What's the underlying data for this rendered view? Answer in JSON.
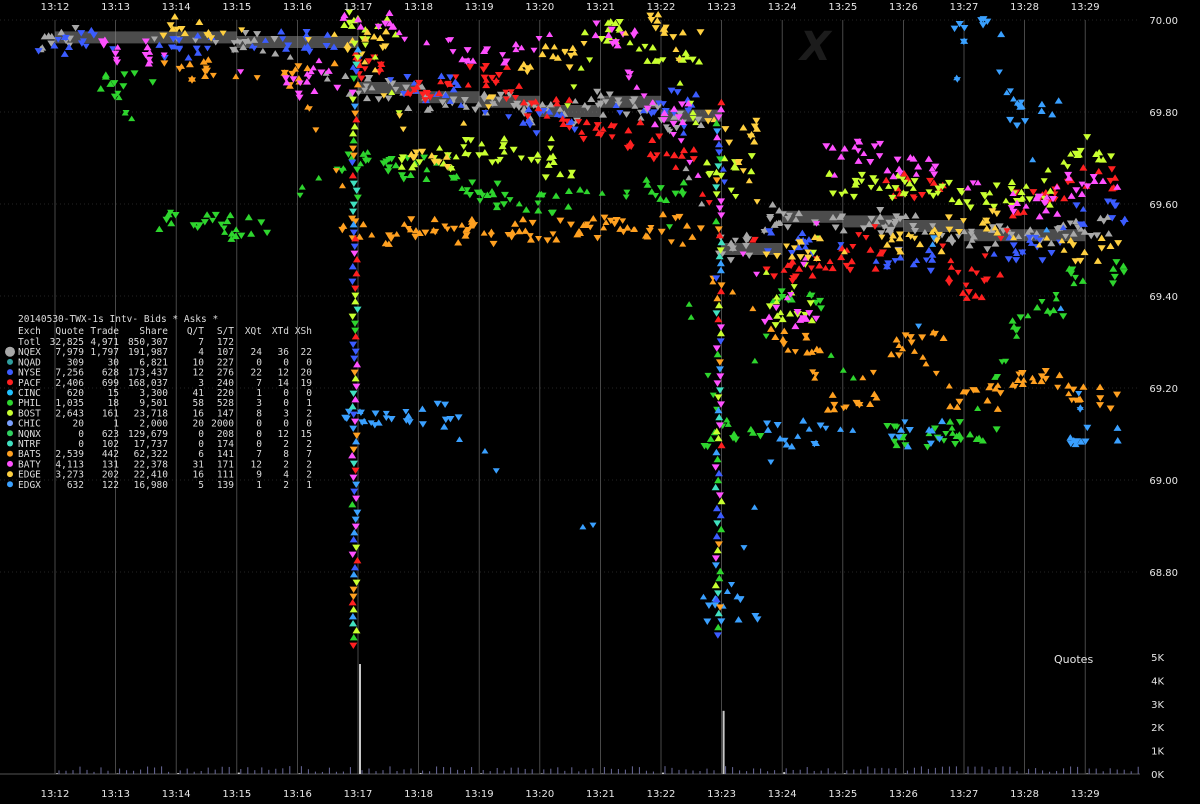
{
  "chart_data": [
    {
      "type": "scatter",
      "title": "",
      "xlabel": "",
      "ylabel": "",
      "x_ticks": [
        "13:12",
        "13:13",
        "13:14",
        "13:15",
        "13:16",
        "13:17",
        "13:18",
        "13:19",
        "13:20",
        "13:21",
        "13:22",
        "13:23",
        "13:24",
        "13:25",
        "13:26",
        "13:27",
        "13:28",
        "13:29"
      ],
      "y_ticks": [
        "70.00",
        "69.80",
        "69.60",
        "69.40",
        "69.20",
        "69.00",
        "68.80"
      ],
      "ylim": [
        68.6,
        70.05
      ],
      "grid": true,
      "watermark": "X",
      "legend": {
        "title": "20140530-TWX-1s Intv- Bids * Asks *",
        "columns": [
          "Exch",
          "Quote",
          "Trade",
          "Share",
          "Q/T",
          "S/T",
          "XQt",
          "XTd",
          "XSh"
        ],
        "rows": [
          {
            "exch": "Totl",
            "quote": "32,825",
            "trade": "4,971",
            "share": "850,307",
            "qt": "7",
            "st": "172",
            "xqt": "",
            "xtd": "",
            "xsh": "",
            "color": ""
          },
          {
            "exch": "NQEX",
            "quote": "7,979",
            "trade": "1,797",
            "share": "191,987",
            "qt": "4",
            "st": "107",
            "xqt": "24",
            "xtd": "36",
            "xsh": "22",
            "color": "#a8a8a8"
          },
          {
            "exch": "NQAD",
            "quote": "309",
            "trade": "30",
            "share": "6,821",
            "qt": "10",
            "st": "227",
            "xqt": "0",
            "xtd": "0",
            "xsh": "0",
            "color": "#2f9e9e"
          },
          {
            "exch": "NYSE",
            "quote": "7,256",
            "trade": "628",
            "share": "173,437",
            "qt": "12",
            "st": "276",
            "xqt": "22",
            "xtd": "12",
            "xsh": "20",
            "color": "#3b5cff"
          },
          {
            "exch": "PACF",
            "quote": "2,406",
            "trade": "699",
            "share": "168,037",
            "qt": "3",
            "st": "240",
            "xqt": "7",
            "xtd": "14",
            "xsh": "19",
            "color": "#ff2020"
          },
          {
            "exch": "CINC",
            "quote": "620",
            "trade": "15",
            "share": "3,300",
            "qt": "41",
            "st": "220",
            "xqt": "1",
            "xtd": "0",
            "xsh": "0",
            "color": "#20c0ff"
          },
          {
            "exch": "PHIL",
            "quote": "1,035",
            "trade": "18",
            "share": "9,501",
            "qt": "58",
            "st": "528",
            "xqt": "3",
            "xtd": "0",
            "xsh": "1",
            "color": "#2ed52e"
          },
          {
            "exch": "BOST",
            "quote": "2,643",
            "trade": "161",
            "share": "23,718",
            "qt": "16",
            "st": "147",
            "xqt": "8",
            "xtd": "3",
            "xsh": "2",
            "color": "#c8ff30"
          },
          {
            "exch": "CHIC",
            "quote": "20",
            "trade": "1",
            "share": "2,000",
            "qt": "20",
            "st": "2000",
            "xqt": "0",
            "xtd": "0",
            "xsh": "0",
            "color": "#7aa0ff"
          },
          {
            "exch": "NQNX",
            "quote": "0",
            "trade": "623",
            "share": "129,679",
            "qt": "0",
            "st": "208",
            "xqt": "0",
            "xtd": "12",
            "xsh": "15",
            "color": "#30d060"
          },
          {
            "exch": "NTRF",
            "quote": "0",
            "trade": "102",
            "share": "17,737",
            "qt": "0",
            "st": "174",
            "xqt": "0",
            "xtd": "2",
            "xsh": "2",
            "color": "#40e0c0"
          },
          {
            "exch": "BATS",
            "quote": "2,539",
            "trade": "442",
            "share": "62,322",
            "qt": "6",
            "st": "141",
            "xqt": "7",
            "xtd": "8",
            "xsh": "7",
            "color": "#ffa020"
          },
          {
            "exch": "BATY",
            "quote": "4,113",
            "trade": "131",
            "share": "22,378",
            "qt": "31",
            "st": "171",
            "xqt": "12",
            "xtd": "2",
            "xsh": "2",
            "color": "#ff50ff"
          },
          {
            "exch": "EDGE",
            "quote": "3,273",
            "trade": "202",
            "share": "22,410",
            "qt": "16",
            "st": "111",
            "xqt": "9",
            "xtd": "4",
            "xsh": "2",
            "color": "#ffd040"
          },
          {
            "exch": "EDGX",
            "quote": "632",
            "trade": "122",
            "share": "16,980",
            "qt": "5",
            "st": "139",
            "xqt": "1",
            "xtd": "2",
            "xsh": "1",
            "color": "#3aa0ff"
          }
        ]
      },
      "series": [
        {
          "name": "NQEX",
          "color": "#a8a8a8",
          "x": [
            "13:12",
            "13:15",
            "13:17",
            "13:18",
            "13:19",
            "13:20",
            "13:21",
            "13:22",
            "13:23",
            "13:24",
            "13:25",
            "13:26",
            "13:27",
            "13:28",
            "13:29"
          ],
          "y": [
            69.96,
            69.95,
            69.85,
            69.83,
            69.82,
            69.8,
            69.82,
            69.79,
            69.5,
            69.57,
            69.56,
            69.55,
            69.53,
            69.53,
            69.55
          ]
        },
        {
          "name": "NYSE",
          "color": "#3b5cff",
          "x": [
            "13:12",
            "13:14",
            "13:16",
            "13:18",
            "13:20",
            "13:22",
            "13:24",
            "13:26",
            "13:28",
            "13:29"
          ],
          "y": [
            69.95,
            69.94,
            69.96,
            69.85,
            69.78,
            69.82,
            69.52,
            69.48,
            69.5,
            69.58
          ]
        },
        {
          "name": "PACF",
          "color": "#ff2020",
          "x": [
            "13:17",
            "13:18",
            "13:19",
            "13:20",
            "13:21",
            "13:22",
            "13:24",
            "13:25",
            "13:26",
            "13:27",
            "13:28",
            "13:29"
          ],
          "y": [
            69.9,
            69.84,
            69.88,
            69.8,
            69.75,
            69.72,
            69.45,
            69.48,
            69.64,
            69.42,
            69.6,
            69.65
          ]
        },
        {
          "name": "PHIL",
          "color": "#2ed52e",
          "x": [
            "13:13",
            "13:14",
            "13:15",
            "13:17",
            "13:18",
            "13:19",
            "13:20",
            "13:22",
            "13:23",
            "13:24",
            "13:26",
            "13:27",
            "13:28",
            "13:29"
          ],
          "y": [
            69.86,
            69.55,
            69.55,
            69.7,
            69.68,
            69.62,
            69.61,
            69.63,
            69.1,
            69.4,
            69.1,
            69.1,
            69.35,
            69.45
          ]
        },
        {
          "name": "BOST",
          "color": "#c8ff30",
          "x": [
            "13:17",
            "13:18",
            "13:19",
            "13:20",
            "13:21",
            "13:22",
            "13:23",
            "13:24",
            "13:25",
            "13:26",
            "13:27",
            "13:28",
            "13:29"
          ],
          "y": [
            69.99,
            69.7,
            69.72,
            69.68,
            69.98,
            69.93,
            69.68,
            69.36,
            69.64,
            69.64,
            69.62,
            69.62,
            69.72
          ]
        },
        {
          "name": "BATS",
          "color": "#ffa020",
          "x": [
            "13:14",
            "13:16",
            "13:17",
            "13:18",
            "13:19",
            "13:20",
            "13:21",
            "13:22",
            "13:24",
            "13:25",
            "13:26",
            "13:27",
            "13:28",
            "13:29"
          ],
          "y": [
            69.89,
            69.88,
            69.54,
            69.54,
            69.54,
            69.54,
            69.55,
            69.55,
            69.3,
            69.16,
            69.3,
            69.18,
            69.22,
            69.18
          ]
        },
        {
          "name": "BATY",
          "color": "#ff50ff",
          "x": [
            "13:13",
            "13:16",
            "13:17",
            "13:19",
            "13:21",
            "13:22",
            "13:24",
            "13:25",
            "13:26",
            "13:28",
            "13:29"
          ],
          "y": [
            69.93,
            69.86,
            69.99,
            69.93,
            69.97,
            69.8,
            69.35,
            69.72,
            69.68,
            69.6,
            69.64
          ]
        },
        {
          "name": "EDGE",
          "color": "#ffd040",
          "x": [
            "13:14",
            "13:17",
            "13:18",
            "13:20",
            "13:22",
            "13:23",
            "13:24",
            "13:26",
            "13:27",
            "13:29"
          ],
          "y": [
            69.98,
            69.95,
            69.7,
            69.92,
            69.99,
            69.76,
            69.5,
            69.52,
            69.56,
            69.5
          ]
        },
        {
          "name": "EDGX",
          "color": "#3aa0ff",
          "x": [
            "13:17",
            "13:18",
            "13:23",
            "13:24",
            "13:26",
            "13:27",
            "13:28",
            "13:29"
          ],
          "y": [
            69.14,
            69.14,
            68.72,
            69.1,
            69.1,
            69.98,
            69.8,
            69.1
          ]
        }
      ],
      "price_dips": [
        {
          "time": "13:17",
          "from": 69.95,
          "to": 68.63
        },
        {
          "time": "13:23",
          "from": 69.82,
          "to": 68.66
        }
      ]
    },
    {
      "type": "bar",
      "title": "Quotes",
      "y_ticks": [
        "5K",
        "4K",
        "3K",
        "2K",
        "1K",
        "0K"
      ],
      "ylim": [
        0,
        5000
      ],
      "x": [
        "13:12",
        "13:13",
        "13:14",
        "13:15",
        "13:16",
        "13:17",
        "13:18",
        "13:19",
        "13:20",
        "13:21",
        "13:22",
        "13:23",
        "13:24",
        "13:25",
        "13:26",
        "13:27",
        "13:28",
        "13:29"
      ],
      "values": [
        30,
        25,
        40,
        60,
        30,
        4700,
        40,
        30,
        25,
        20,
        60,
        2700,
        80,
        30,
        25,
        20,
        20,
        25
      ]
    }
  ]
}
